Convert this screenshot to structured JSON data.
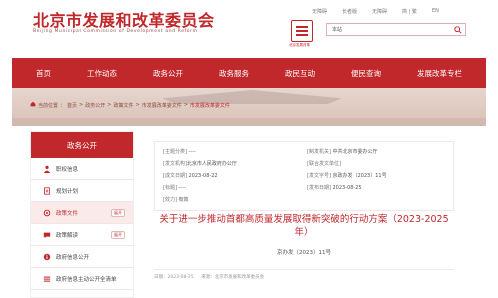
{
  "header": {
    "site_title": "北京市发展和改革委员会",
    "site_subtitle": "Beijing Municipal Commission of Development and Reform",
    "emblem_caption": "北京发展改革",
    "top_links": [
      "无障碍",
      "长者版",
      "无障碍",
      "简 | 繁",
      "EN"
    ],
    "search": {
      "scope": "本站",
      "placeholder": ""
    }
  },
  "nav": {
    "items": [
      "首页",
      "工作动态",
      "政务公开",
      "政务服务",
      "政民互动",
      "便民查询",
      "发展改革专栏"
    ]
  },
  "breadcrumb": {
    "items": [
      "当前位置",
      "首页",
      "政务公开",
      "政策文件",
      "市发展改革委文件",
      "市发展改革委文件"
    ]
  },
  "sidebar": {
    "title": "政务公开",
    "items": [
      {
        "label": "职权信息",
        "icon": "person-icon",
        "tag": ""
      },
      {
        "label": "规划计划",
        "icon": "document-icon",
        "tag": ""
      },
      {
        "label": "政策文件",
        "icon": "policy-icon",
        "tag": "展开"
      },
      {
        "label": "政策解读",
        "icon": "chat-icon",
        "tag": "展开"
      },
      {
        "label": "政府信息公开",
        "icon": "info-icon",
        "tag": ""
      },
      {
        "label": "政府信息主动公开全清单",
        "icon": "list-icon",
        "tag": ""
      }
    ]
  },
  "document": {
    "meta": {
      "theme_label": "[主题分类]",
      "theme_value": "----",
      "issuer_label": "[发文机构]",
      "issuer_value": "北京市人民政府办公厅",
      "written_label": "[成文日期]",
      "written_value": "2023-08-22",
      "title_label": "[标题]",
      "title_value": "----",
      "effect_label": "[效力]",
      "effect_value": "有效",
      "topic_label": "[制发机关]",
      "topic_value": "中共北京市委办公厅",
      "unit_label": "[联合发文单位]",
      "unit_value": "",
      "number_label": "[发文字号]",
      "number_value": "京政办发〔2023〕11号",
      "publish_label": "[发布日期]",
      "publish_value": "2023-08-25"
    },
    "title": "关于进一步推动首都高质量发展取得新突破的行动方案（2023-2025年）",
    "number_line": "京办发〔2023〕11号",
    "footer": [
      "日期：2023-08-25",
      "来源：北京市发展和改革委员会"
    ]
  }
}
